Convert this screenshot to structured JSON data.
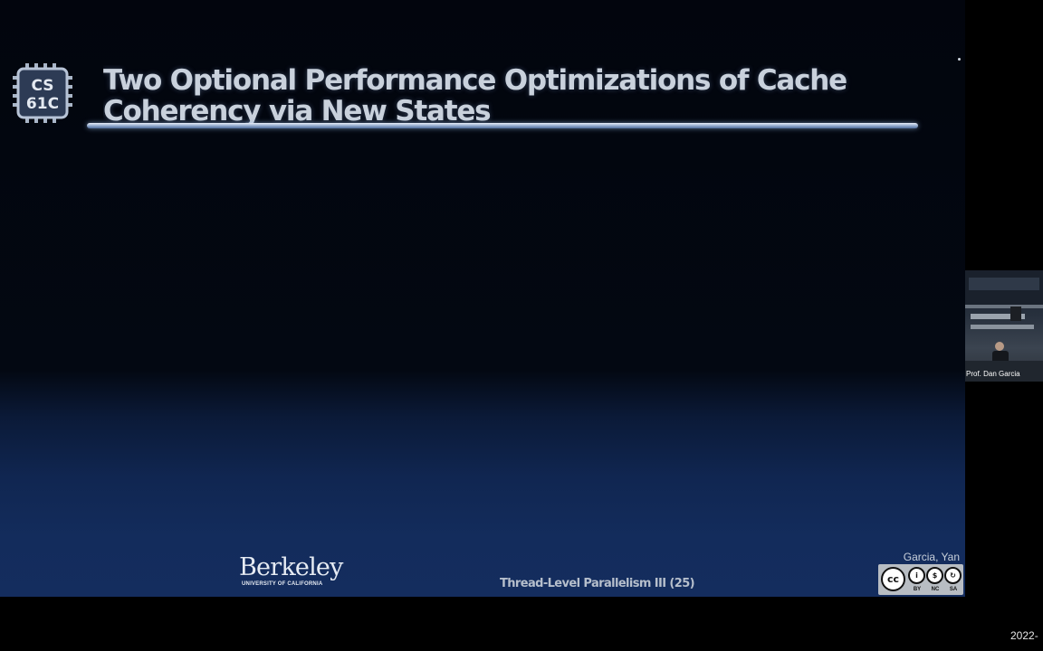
{
  "slide": {
    "logo": {
      "line1": "CS",
      "line2": "61C"
    },
    "title": "Two Optional Performance Optimizations of Cache Coherency via New States",
    "footer": {
      "university_name": "Berkeley",
      "university_sub": "UNIVERSITY OF CALIFORNIA",
      "lecture": "Thread-Level Parallelism III (25)",
      "authors": "Garcia, Yan"
    },
    "license": {
      "labels": [
        "BY",
        "NC",
        "SA"
      ]
    }
  },
  "video_overlay": {
    "speaker_name": "Prof. Dan Garcia"
  },
  "timestamp": "2022-",
  "colors": {
    "slide_bottom": "#142d5e",
    "title_text": "#c9d1dc",
    "rule_glow": "#9fb4d4"
  }
}
